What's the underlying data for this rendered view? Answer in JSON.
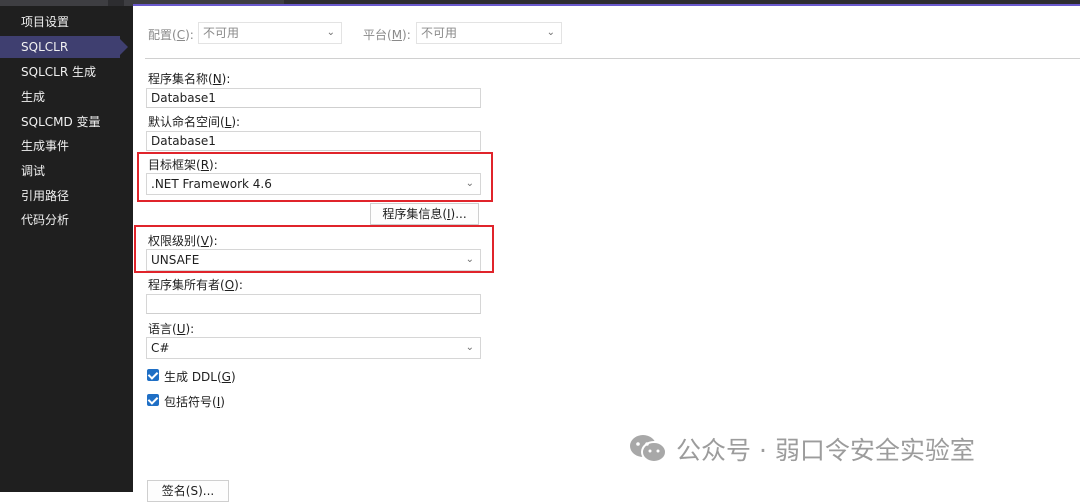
{
  "sidebar": {
    "items": [
      {
        "label": "项目设置"
      },
      {
        "label": "SQLCLR"
      },
      {
        "label": "SQLCLR 生成"
      },
      {
        "label": "生成"
      },
      {
        "label": "SQLCMD 变量"
      },
      {
        "label": "生成事件"
      },
      {
        "label": "调试"
      },
      {
        "label": "引用路径"
      },
      {
        "label": "代码分析"
      }
    ],
    "active_index": 1
  },
  "config_bar": {
    "config_label": "配置(",
    "config_key": "C",
    "config_label_end": "):",
    "config_value": "不可用",
    "platform_label": "平台(",
    "platform_key": "M",
    "platform_label_end": "):",
    "platform_value": "不可用"
  },
  "form": {
    "assembly_name_label": "程序集名称(",
    "assembly_name_key": "N",
    "assembly_name_end": "):",
    "assembly_name_value": "Database1",
    "namespace_label": "默认命名空间(",
    "namespace_key": "L",
    "namespace_end": "):",
    "namespace_value": "Database1",
    "target_framework_label": "目标框架(",
    "target_framework_key": "R",
    "target_framework_end": "):",
    "target_framework_value": ".NET Framework 4.6",
    "assembly_info_button": "程序集信息(",
    "assembly_info_key": "I",
    "assembly_info_end": ")...",
    "permission_label": "权限级别(",
    "permission_key": "V",
    "permission_end": "):",
    "permission_value": "UNSAFE",
    "owner_label": "程序集所有者(",
    "owner_key": "O",
    "owner_end": "):",
    "owner_value": "",
    "language_label": "语言(",
    "language_key": "U",
    "language_end": "):",
    "language_value": "C#",
    "gen_ddl_label": "生成 DDL(",
    "gen_ddl_key": "G",
    "gen_ddl_end": ")",
    "gen_ddl_checked": true,
    "include_symbols_label": "包括符号(",
    "include_symbols_key": "I",
    "include_symbols_end": ")",
    "include_symbols_checked": true,
    "sign_button": "签名(S)..."
  },
  "watermark": {
    "text": "公众号 · 弱口令安全实验室"
  },
  "colors": {
    "sidebar_bg": "#1f1f1f",
    "sidebar_active": "#3f3f70",
    "highlight_red": "#e0242b",
    "checkbox_blue": "#1f6fc5",
    "accent": "#6a5acd"
  }
}
